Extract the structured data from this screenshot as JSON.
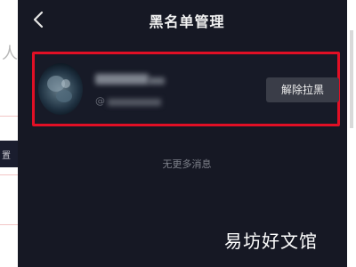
{
  "header": {
    "title": "黑名单管理"
  },
  "blocked_users": [
    {
      "handle_prefix": "@",
      "unblock_label": "解除拉黑"
    }
  ],
  "list_footer": {
    "text": "无更多消息"
  },
  "watermark": {
    "text": "易坊好文馆"
  },
  "background_page": {
    "partial_text": "人",
    "tile_text": "置"
  },
  "colors": {
    "screen_bg": "#161824",
    "highlight_border": "#e10f25",
    "button_bg": "#3a3d48",
    "title_text": "#f2f2f2"
  },
  "icons": {
    "back": "chevron-left-icon"
  }
}
